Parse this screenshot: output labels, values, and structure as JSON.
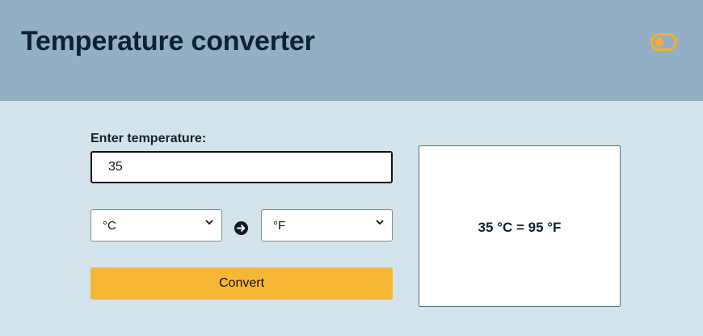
{
  "header": {
    "title": "Temperature converter",
    "toggle_icon": "toggle-icon",
    "toggle_color": "#f3b221"
  },
  "form": {
    "label": "Enter temperature:",
    "input_value": "35",
    "from_unit": "°C",
    "to_unit": "°F",
    "arrow_icon": "arrow-right-circle-icon",
    "convert_label": "Convert"
  },
  "result": {
    "text": "35 °C = 95 °F"
  },
  "colors": {
    "header_bg": "#93afc3",
    "page_bg": "#d3e3ec",
    "accent": "#f6b834"
  }
}
